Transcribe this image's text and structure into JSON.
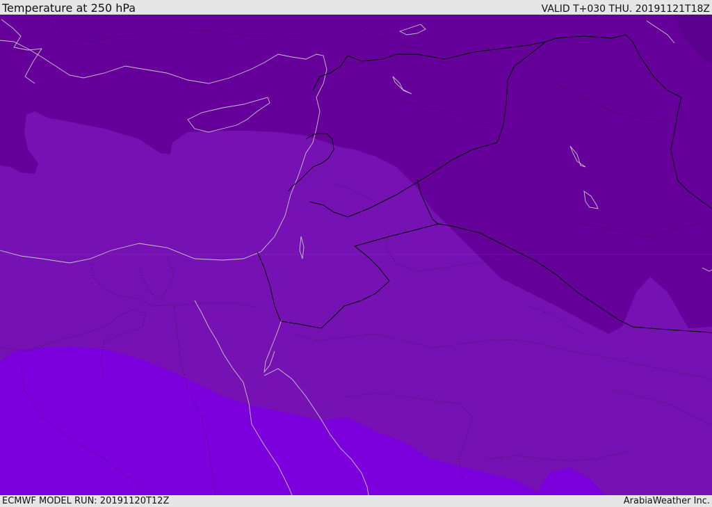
{
  "header": {
    "title": "Temperature at 250 hPa",
    "valid": "VALID T+030 THU. 20191121T18Z"
  },
  "footer": {
    "model_run": "ECMWF MODEL RUN: 20191120T12Z",
    "brand": "ArabiaWeather Inc."
  },
  "colors": {
    "coldest_band": "#65009a",
    "middle_band": "#7612b3",
    "warmest_band": "#7c00dd",
    "cold_pocket": "#5c0090",
    "coastline": "#c8c8c8",
    "border": "#000000"
  }
}
